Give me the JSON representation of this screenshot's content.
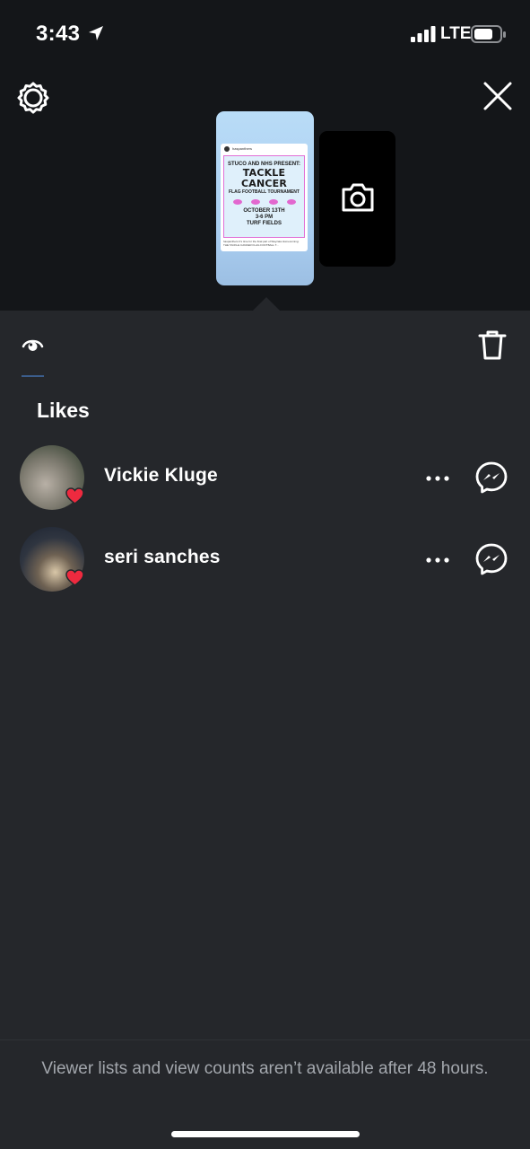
{
  "status_bar": {
    "time": "3:43",
    "network": "LTE",
    "icons": [
      "location-arrow-icon",
      "signal-bars-icon",
      "battery-icon"
    ]
  },
  "header": {
    "icons": [
      "settings-icon",
      "close-icon"
    ]
  },
  "story_preview": {
    "post_header": "haspanthers",
    "flyer": {
      "line1": "STUCO AND NHS PRESENT:",
      "line2": "TACKLE CANCER",
      "line3": "FLAG FOOTBALL TOURNAMENT",
      "line4": "OCTOBER 13TH",
      "line5": "3-6 PM",
      "line6": "TURF FIELDS"
    },
    "caption": "haspanthers It's time for the final part of Wayzata Homecoming: THE TACKLE CANCER FLAG FOOTBALL T..."
  },
  "add_story": {
    "icon": "camera-icon"
  },
  "tabs": {
    "icons": [
      "viewers-eye-icon",
      "trash-icon"
    ],
    "accent": "#3b5d8c"
  },
  "likes": {
    "title": "Likes",
    "users": [
      {
        "name": "Vickie Kluge"
      },
      {
        "name": "seri sanches"
      }
    ],
    "heart_color": "#ee2a3f"
  },
  "footer": {
    "note": "Viewer lists and view counts aren’t available after 48 hours."
  },
  "colors": {
    "top_background": "#141619",
    "panel_background": "#25272b",
    "muted_text": "#a3a7ad"
  }
}
